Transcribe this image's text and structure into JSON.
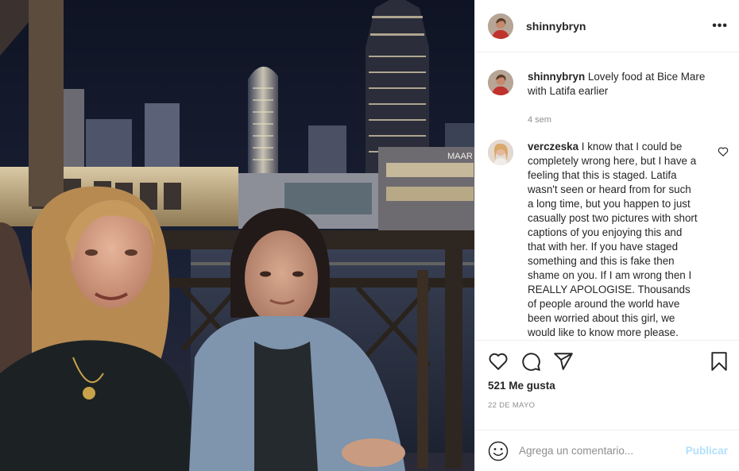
{
  "post": {
    "username": "shinnybryn",
    "more_icon": "more-options-icon"
  },
  "caption": {
    "username": "shinnybryn",
    "text": "Lovely food at Bice Mare with Latifa earlier",
    "time": "4 sem"
  },
  "comment": {
    "username": "verczeska",
    "text": "I know that I could be completely wrong here, but I have a feeling that this is staged. Latifa wasn't seen or heard from for such a long time, but you happen to just casually post two pictures with short captions of you enjoying this and that with her. If you have staged something and this is fake then shame on you. If I am wrong then I REALLY APOLOGISE. Thousands of people around the world have been worried about this girl, we would like to know more please."
  },
  "actions": {
    "icons": [
      "heart-icon",
      "comment-icon",
      "share-icon",
      "bookmark-icon"
    ],
    "likes": "521 Me gusta",
    "date": "22 DE MAYO"
  },
  "add_comment": {
    "placeholder": "Agrega un comentario...",
    "publish_label": "Publicar"
  },
  "photo": {
    "sign_text": "MAAR"
  }
}
